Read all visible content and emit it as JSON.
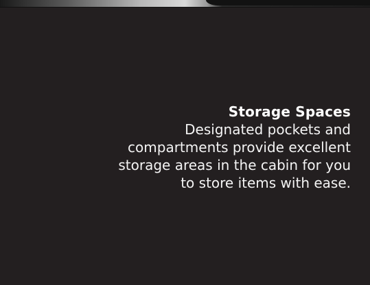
{
  "feature": {
    "title": "Storage Spaces",
    "body_lines": [
      "Designated pockets and",
      "compartments provide excellent",
      "storage areas in the cabin for you",
      "to store items with ease."
    ]
  },
  "colors": {
    "background": "#231f20",
    "text": "#ffffff"
  }
}
